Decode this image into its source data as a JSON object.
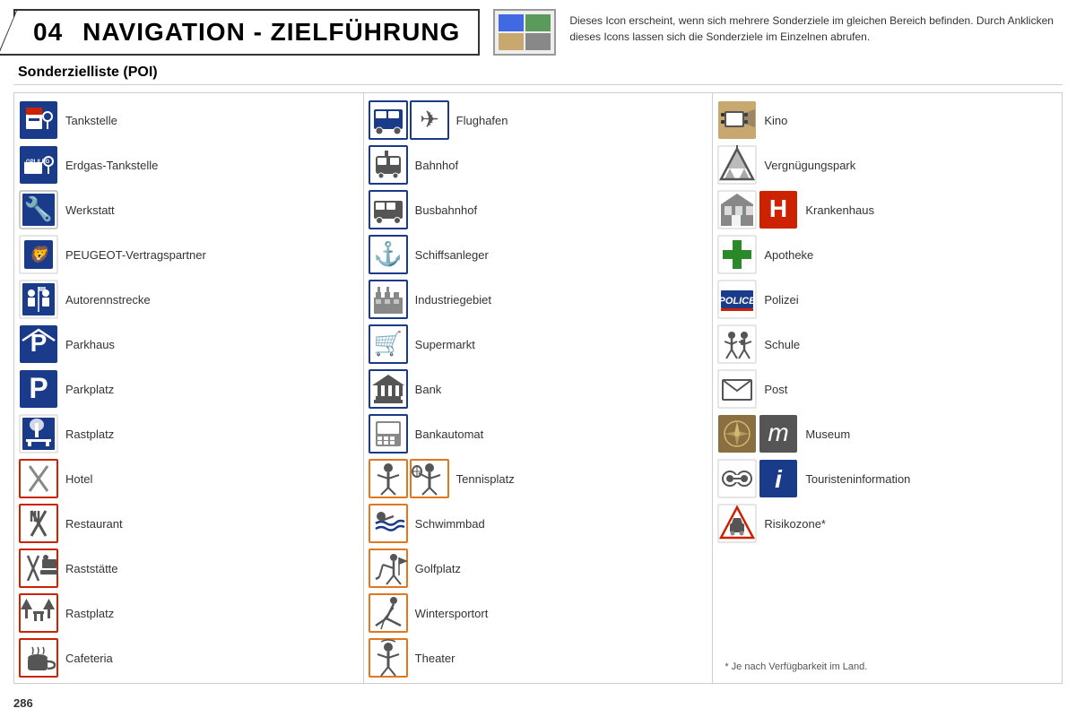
{
  "header": {
    "chapter": "04",
    "title": "NAVIGATION - ZIELFÜHRUNG",
    "description": "Dieses Icon erscheint, wenn sich mehrere Sonderziele im gleichen Bereich befinden. Durch Anklicken dieses Icons lassen sich die Sonderziele im Einzelnen abrufen."
  },
  "section_title": "Sonderzielliste (POI)",
  "columns": {
    "col1": {
      "items": [
        {
          "label": "Tankstelle",
          "icon_type": "gas"
        },
        {
          "label": "Erdgas-Tankstelle",
          "icon_type": "erdgas"
        },
        {
          "label": "Werkstatt",
          "icon_type": "werkstatt"
        },
        {
          "label": "PEUGEOT-Vertragspartner",
          "icon_type": "peugeot"
        },
        {
          "label": "Autorennstrecke",
          "icon_type": "rennstrecke"
        },
        {
          "label": "Parkhaus",
          "icon_type": "parkhaus"
        },
        {
          "label": "Parkplatz",
          "icon_type": "parkplatz"
        },
        {
          "label": "Rastplatz",
          "icon_type": "rastplatz"
        },
        {
          "label": "Hotel",
          "icon_type": "hotel"
        },
        {
          "label": "Restaurant",
          "icon_type": "restaurant"
        },
        {
          "label": "Raststätte",
          "icon_type": "raststaette"
        },
        {
          "label": "Rastplatz",
          "icon_type": "rastplatz2"
        },
        {
          "label": "Cafeteria",
          "icon_type": "cafeteria"
        }
      ]
    },
    "col2": {
      "items": [
        {
          "label": "Flughafen",
          "icon_type": "flughafen"
        },
        {
          "label": "Bahnhof",
          "icon_type": "bahnhof"
        },
        {
          "label": "Busbahnhof",
          "icon_type": "busbahnhof"
        },
        {
          "label": "Schiffsanleger",
          "icon_type": "schiff"
        },
        {
          "label": "Industriegebiet",
          "icon_type": "industrie"
        },
        {
          "label": "Supermarkt",
          "icon_type": "supermarkt"
        },
        {
          "label": "Bank",
          "icon_type": "bank"
        },
        {
          "label": "Bankautomat",
          "icon_type": "bankautomat"
        },
        {
          "label": "Tennisplatz",
          "icon_type": "tennis"
        },
        {
          "label": "Schwimmbad",
          "icon_type": "schwimmbad"
        },
        {
          "label": "Golfplatz",
          "icon_type": "golf"
        },
        {
          "label": "Wintersportort",
          "icon_type": "wintersport"
        },
        {
          "label": "Theater",
          "icon_type": "theater"
        }
      ]
    },
    "col3": {
      "items": [
        {
          "label": "Kino",
          "icon_type": "kino"
        },
        {
          "label": "Vergnügungspark",
          "icon_type": "vergnuegung"
        },
        {
          "label": "Krankenhaus",
          "icon_type": "krankenhaus"
        },
        {
          "label": "Apotheke",
          "icon_type": "apotheke"
        },
        {
          "label": "Polizei",
          "icon_type": "polizei"
        },
        {
          "label": "Schule",
          "icon_type": "schule"
        },
        {
          "label": "Post",
          "icon_type": "post"
        },
        {
          "label": "Museum",
          "icon_type": "museum"
        },
        {
          "label": "Touristeninformation",
          "icon_type": "tourist"
        },
        {
          "label": "Risikozone*",
          "icon_type": "risiko"
        }
      ],
      "footnote": "* Je nach Verfügbarkeit im Land."
    }
  },
  "page_number": "286"
}
